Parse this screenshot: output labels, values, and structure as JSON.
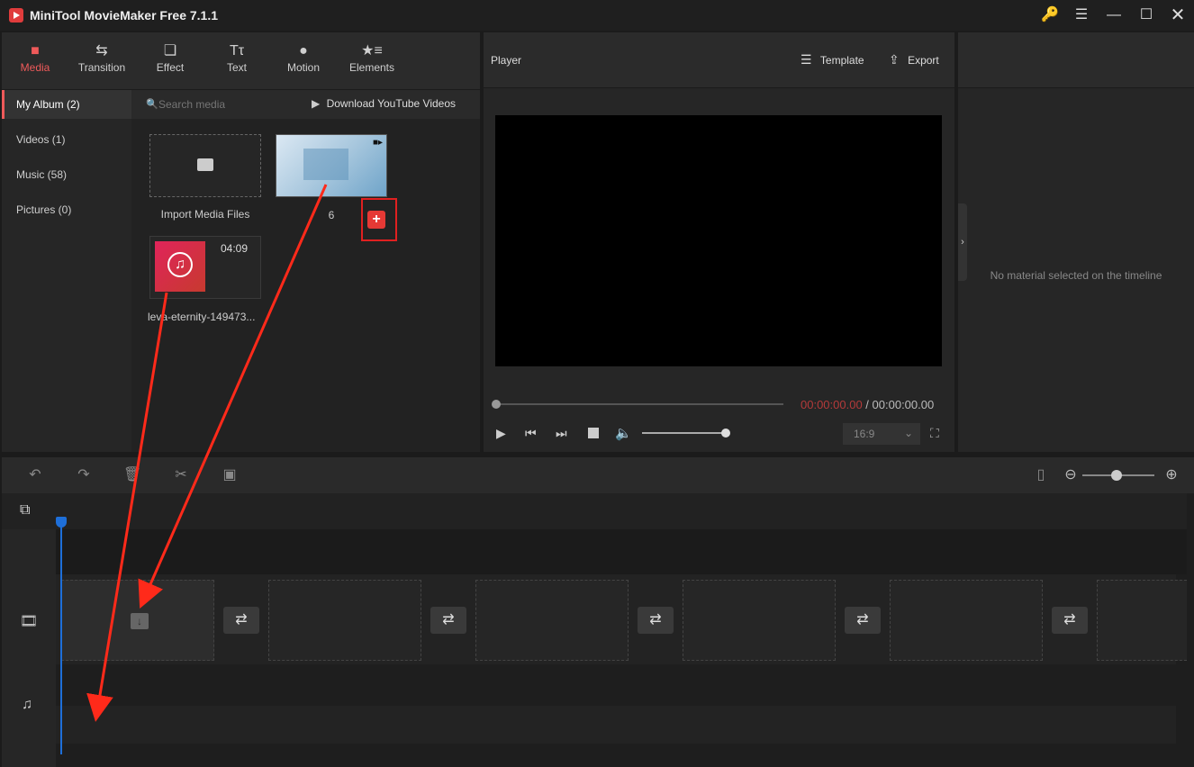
{
  "app": {
    "title": "MiniTool MovieMaker Free 7.1.1",
    "window_controls": [
      "key-icon",
      "menu-icon",
      "minimize-icon",
      "maximize-icon",
      "close-icon"
    ]
  },
  "toolbar": {
    "tabs": [
      {
        "label": "Media",
        "icon": "folder-icon",
        "active": true
      },
      {
        "label": "Transition",
        "icon": "swap-icon",
        "active": false
      },
      {
        "label": "Effect",
        "icon": "effect-icon",
        "active": false
      },
      {
        "label": "Text",
        "icon": "text-icon",
        "active": false
      },
      {
        "label": "Motion",
        "icon": "motion-icon",
        "active": false
      },
      {
        "label": "Elements",
        "icon": "elements-icon",
        "active": false
      }
    ]
  },
  "album_nav": {
    "items": [
      {
        "label": "My Album (2)",
        "active": true
      },
      {
        "label": "Videos (1)",
        "active": false
      },
      {
        "label": "Music (58)",
        "active": false
      },
      {
        "label": "Pictures (0)",
        "active": false
      }
    ]
  },
  "media": {
    "search_placeholder": "Search media",
    "download_label": "Download YouTube Videos",
    "import_label": "Import Media Files",
    "items": [
      {
        "name": "6",
        "type": "video"
      },
      {
        "name": "leva-eternity-149473...",
        "type": "music",
        "duration": "04:09"
      }
    ]
  },
  "player": {
    "title": "Player",
    "template_label": "Template",
    "export_label": "Export",
    "current_time": "00:00:00.00",
    "separator": " / ",
    "total_time": "00:00:00.00",
    "aspect_ratio": "16:9",
    "volume_level": 1.0,
    "progress": 0
  },
  "properties": {
    "empty_message": "No material selected on the timeline"
  },
  "timeline": {
    "zoom_level": 0.6,
    "slots": 6,
    "colors": {
      "accent": "#ef5a5a",
      "playhead": "#1e6fd9",
      "annotation": "#ff2a1a"
    }
  }
}
